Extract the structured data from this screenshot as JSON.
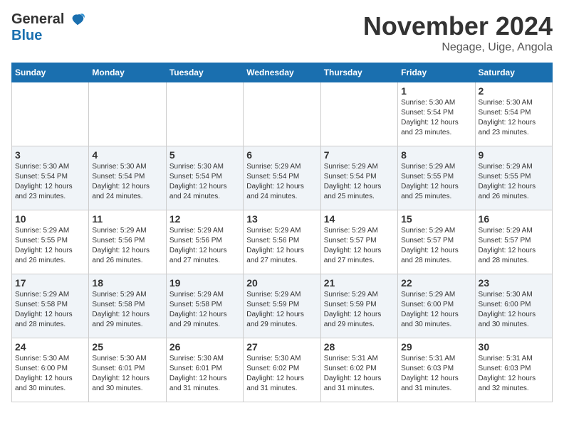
{
  "logo": {
    "line1": "General",
    "line2": "Blue"
  },
  "title": "November 2024",
  "location": "Negage, Uige, Angola",
  "days_of_week": [
    "Sunday",
    "Monday",
    "Tuesday",
    "Wednesday",
    "Thursday",
    "Friday",
    "Saturday"
  ],
  "weeks": [
    [
      {
        "day": "",
        "info": ""
      },
      {
        "day": "",
        "info": ""
      },
      {
        "day": "",
        "info": ""
      },
      {
        "day": "",
        "info": ""
      },
      {
        "day": "",
        "info": ""
      },
      {
        "day": "1",
        "info": "Sunrise: 5:30 AM\nSunset: 5:54 PM\nDaylight: 12 hours\nand 23 minutes."
      },
      {
        "day": "2",
        "info": "Sunrise: 5:30 AM\nSunset: 5:54 PM\nDaylight: 12 hours\nand 23 minutes."
      }
    ],
    [
      {
        "day": "3",
        "info": "Sunrise: 5:30 AM\nSunset: 5:54 PM\nDaylight: 12 hours\nand 23 minutes."
      },
      {
        "day": "4",
        "info": "Sunrise: 5:30 AM\nSunset: 5:54 PM\nDaylight: 12 hours\nand 24 minutes."
      },
      {
        "day": "5",
        "info": "Sunrise: 5:30 AM\nSunset: 5:54 PM\nDaylight: 12 hours\nand 24 minutes."
      },
      {
        "day": "6",
        "info": "Sunrise: 5:29 AM\nSunset: 5:54 PM\nDaylight: 12 hours\nand 24 minutes."
      },
      {
        "day": "7",
        "info": "Sunrise: 5:29 AM\nSunset: 5:54 PM\nDaylight: 12 hours\nand 25 minutes."
      },
      {
        "day": "8",
        "info": "Sunrise: 5:29 AM\nSunset: 5:55 PM\nDaylight: 12 hours\nand 25 minutes."
      },
      {
        "day": "9",
        "info": "Sunrise: 5:29 AM\nSunset: 5:55 PM\nDaylight: 12 hours\nand 26 minutes."
      }
    ],
    [
      {
        "day": "10",
        "info": "Sunrise: 5:29 AM\nSunset: 5:55 PM\nDaylight: 12 hours\nand 26 minutes."
      },
      {
        "day": "11",
        "info": "Sunrise: 5:29 AM\nSunset: 5:56 PM\nDaylight: 12 hours\nand 26 minutes."
      },
      {
        "day": "12",
        "info": "Sunrise: 5:29 AM\nSunset: 5:56 PM\nDaylight: 12 hours\nand 27 minutes."
      },
      {
        "day": "13",
        "info": "Sunrise: 5:29 AM\nSunset: 5:56 PM\nDaylight: 12 hours\nand 27 minutes."
      },
      {
        "day": "14",
        "info": "Sunrise: 5:29 AM\nSunset: 5:57 PM\nDaylight: 12 hours\nand 27 minutes."
      },
      {
        "day": "15",
        "info": "Sunrise: 5:29 AM\nSunset: 5:57 PM\nDaylight: 12 hours\nand 28 minutes."
      },
      {
        "day": "16",
        "info": "Sunrise: 5:29 AM\nSunset: 5:57 PM\nDaylight: 12 hours\nand 28 minutes."
      }
    ],
    [
      {
        "day": "17",
        "info": "Sunrise: 5:29 AM\nSunset: 5:58 PM\nDaylight: 12 hours\nand 28 minutes."
      },
      {
        "day": "18",
        "info": "Sunrise: 5:29 AM\nSunset: 5:58 PM\nDaylight: 12 hours\nand 29 minutes."
      },
      {
        "day": "19",
        "info": "Sunrise: 5:29 AM\nSunset: 5:58 PM\nDaylight: 12 hours\nand 29 minutes."
      },
      {
        "day": "20",
        "info": "Sunrise: 5:29 AM\nSunset: 5:59 PM\nDaylight: 12 hours\nand 29 minutes."
      },
      {
        "day": "21",
        "info": "Sunrise: 5:29 AM\nSunset: 5:59 PM\nDaylight: 12 hours\nand 29 minutes."
      },
      {
        "day": "22",
        "info": "Sunrise: 5:29 AM\nSunset: 6:00 PM\nDaylight: 12 hours\nand 30 minutes."
      },
      {
        "day": "23",
        "info": "Sunrise: 5:30 AM\nSunset: 6:00 PM\nDaylight: 12 hours\nand 30 minutes."
      }
    ],
    [
      {
        "day": "24",
        "info": "Sunrise: 5:30 AM\nSunset: 6:00 PM\nDaylight: 12 hours\nand 30 minutes."
      },
      {
        "day": "25",
        "info": "Sunrise: 5:30 AM\nSunset: 6:01 PM\nDaylight: 12 hours\nand 30 minutes."
      },
      {
        "day": "26",
        "info": "Sunrise: 5:30 AM\nSunset: 6:01 PM\nDaylight: 12 hours\nand 31 minutes."
      },
      {
        "day": "27",
        "info": "Sunrise: 5:30 AM\nSunset: 6:02 PM\nDaylight: 12 hours\nand 31 minutes."
      },
      {
        "day": "28",
        "info": "Sunrise: 5:31 AM\nSunset: 6:02 PM\nDaylight: 12 hours\nand 31 minutes."
      },
      {
        "day": "29",
        "info": "Sunrise: 5:31 AM\nSunset: 6:03 PM\nDaylight: 12 hours\nand 31 minutes."
      },
      {
        "day": "30",
        "info": "Sunrise: 5:31 AM\nSunset: 6:03 PM\nDaylight: 12 hours\nand 32 minutes."
      }
    ]
  ]
}
